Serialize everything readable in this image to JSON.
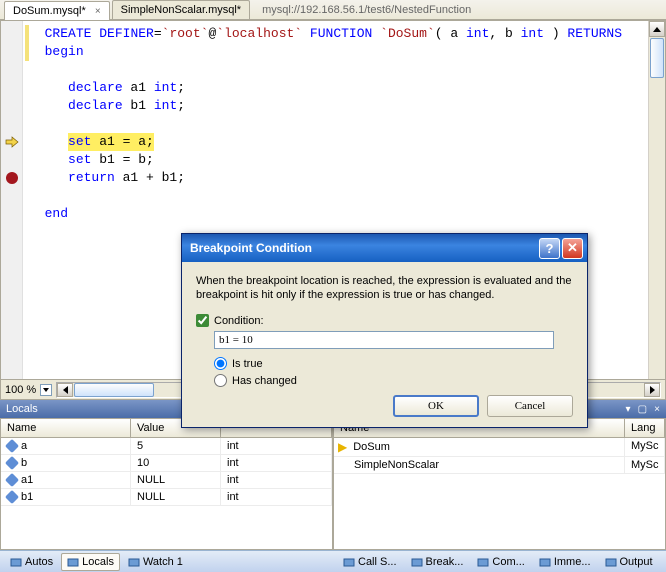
{
  "tabs": {
    "active": "DoSum.mysql*",
    "second": "SimpleNonScalar.mysql*",
    "path": "mysql://192.168.56.1/test6/NestedFunction"
  },
  "code": {
    "l1_kw1": "CREATE",
    "l1_kw2": "DEFINER",
    "l1_eq": "=",
    "l1_s1": "`root`",
    "l1_at": "@",
    "l1_s2": "`localhost`",
    "l1_kw3": "FUNCTION",
    "l1_s3": "`DoSum`",
    "l1_p": "( a ",
    "l1_kw4": "int",
    "l1_c": ", b ",
    "l1_kw5": "int",
    "l1_p2": " ) ",
    "l1_kw6": "RETURNS",
    "l2": "begin",
    "l4_kw": "declare",
    "l4_rest": " a1 ",
    "l4_kw2": "int",
    "l4_semi": ";",
    "l5_kw": "declare",
    "l5_rest": " b1 ",
    "l5_kw2": "int",
    "l5_semi": ";",
    "l7_kw": "set",
    "l7_rest": " a1 = a;",
    "l8_kw": "set",
    "l8_rest": " b1 = b;",
    "l9_kw": "return",
    "l9_rest": " a1 + b1;",
    "l11": "end"
  },
  "zoom": "100 %",
  "locals": {
    "title": "Locals",
    "cols": {
      "name": "Name",
      "value": "Value",
      "type": ""
    },
    "rows": [
      {
        "name": "a",
        "value": "5",
        "type": "int"
      },
      {
        "name": "b",
        "value": "10",
        "type": "int"
      },
      {
        "name": "a1",
        "value": "NULL",
        "type": "int"
      },
      {
        "name": "b1",
        "value": "NULL",
        "type": "int"
      }
    ]
  },
  "stack": {
    "cols": {
      "name": "Name",
      "lang": "Lang"
    },
    "rows": [
      {
        "name": "DoSum",
        "lang": "MySc",
        "current": true
      },
      {
        "name": "SimpleNonScalar",
        "lang": "MySc",
        "current": false
      }
    ]
  },
  "status_left": [
    {
      "label": "Autos",
      "active": false
    },
    {
      "label": "Locals",
      "active": true
    },
    {
      "label": "Watch 1",
      "active": false
    }
  ],
  "status_right": [
    {
      "label": "Call S..."
    },
    {
      "label": "Break..."
    },
    {
      "label": "Com..."
    },
    {
      "label": "Imme..."
    },
    {
      "label": "Output"
    }
  ],
  "dialog": {
    "title": "Breakpoint Condition",
    "desc": "When the breakpoint location is reached, the expression is evaluated and the breakpoint is hit only if the expression is true or has changed.",
    "cond_label": "Condition:",
    "cond_value": "b1 = 10",
    "radio_true": "Is true",
    "radio_changed": "Has changed",
    "ok": "OK",
    "cancel": "Cancel"
  }
}
